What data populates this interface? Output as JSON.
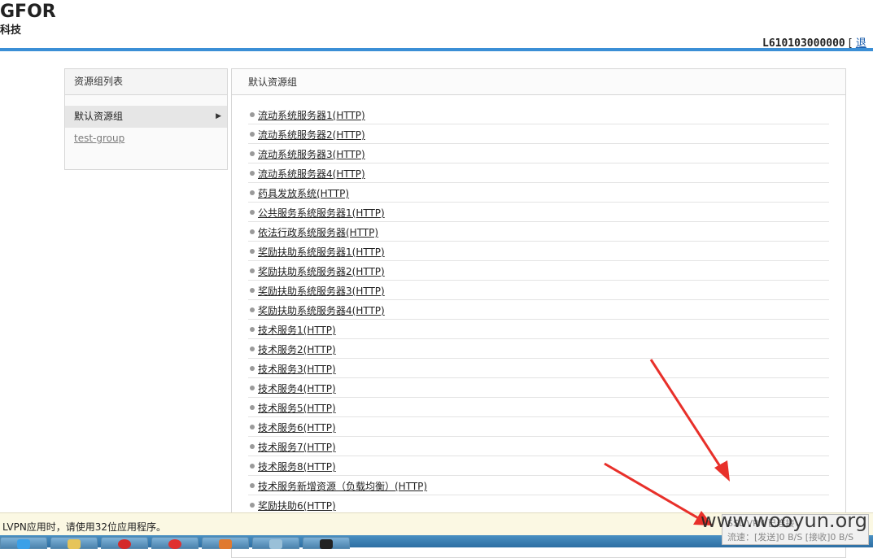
{
  "header": {
    "logo_main": "GFOR",
    "logo_sub": "科技",
    "account_id": "L610103000000",
    "bracket": "[",
    "link_label": "退"
  },
  "left_panel": {
    "title": "资源组列表",
    "groups": [
      {
        "label": "默认资源组",
        "active": true
      },
      {
        "label": "test-group",
        "active": false
      }
    ]
  },
  "main_panel": {
    "title": "默认资源组",
    "resources": [
      "流动系统服务器1(HTTP)",
      "流动系统服务器2(HTTP)",
      "流动系统服务器3(HTTP)",
      "流动系统服务器4(HTTP)",
      "药具发放系统(HTTP)",
      "公共服务系统服务器1(HTTP)",
      "依法行政系统服务器(HTTP)",
      "奖励扶助系统服务器1(HTTP)",
      "奖励扶助系统服务器2(HTTP)",
      "奖励扶助系统服务器3(HTTP)",
      "奖励扶助系统服务器4(HTTP)",
      "技术服务1(HTTP)",
      "技术服务2(HTTP)",
      "技术服务3(HTTP)",
      "技术服务4(HTTP)",
      "技术服务5(HTTP)",
      "技术服务6(HTTP)",
      "技术服务7(HTTP)",
      "技术服务8(HTTP)",
      "技术服务新增资源（负载均衡）(HTTP)",
      "奖励扶助6(HTTP)"
    ]
  },
  "status_bar": {
    "message": "LVPN应用时，请使用32位应用程序。"
  },
  "vpn_popup": {
    "status": "SSL VPN 已连接",
    "speed": "流速：[发送]0 B/S [接收]0 B/S"
  },
  "watermark": "www.wooyun.org",
  "colors": {
    "accent_bar": "#3b8fd6",
    "arrow": "#e8302a",
    "status_bg": "#fbf8e3"
  }
}
